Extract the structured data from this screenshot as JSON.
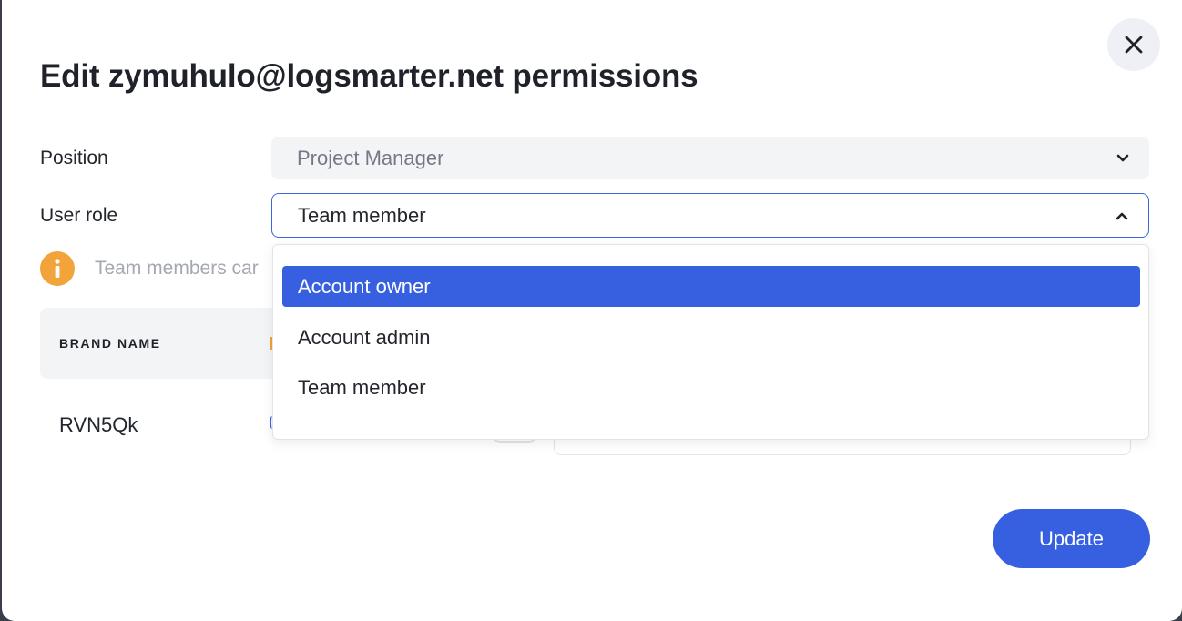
{
  "modal": {
    "title": "Edit zymuhulo@logsmarter.net permissions",
    "close_icon": "close-icon"
  },
  "form": {
    "position_label": "Position",
    "position_value": "Project Manager",
    "user_role_label": "User role",
    "user_role_value": "Team member"
  },
  "info": {
    "icon": "info-icon",
    "text": "Team members car"
  },
  "table": {
    "header_brand": "BRAND NAME",
    "rows": [
      {
        "brand": "RVN5Qk"
      }
    ]
  },
  "dropdown": {
    "options": [
      {
        "label": "Account owner",
        "highlighted": true
      },
      {
        "label": "Account admin",
        "highlighted": false
      },
      {
        "label": "Team member",
        "highlighted": false
      }
    ]
  },
  "actions": {
    "update_label": "Update"
  },
  "colors": {
    "accent": "#3660e0",
    "info": "#f2a33a"
  }
}
